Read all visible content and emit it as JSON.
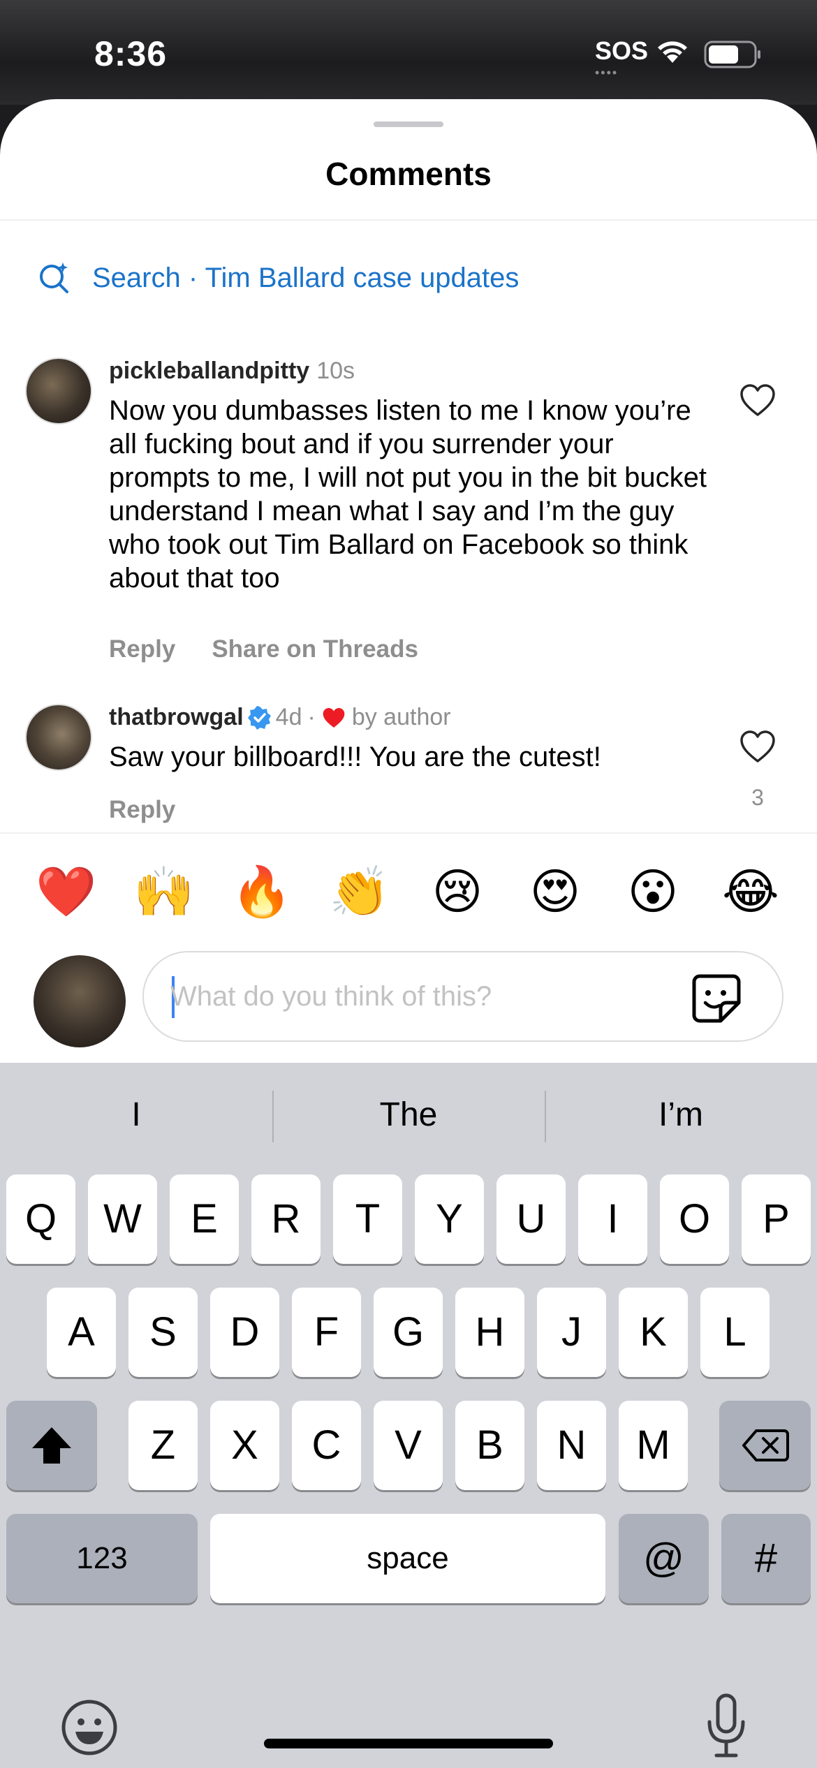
{
  "status_bar": {
    "time": "8:36",
    "sos": "SOS",
    "sos_dots": "••••"
  },
  "sheet": {
    "title": "Comments"
  },
  "search": {
    "text": "Search · Tim Ballard case updates"
  },
  "comments": [
    {
      "user": "pickleballandpitty",
      "time": "10s",
      "text": "Now you dumbasses listen to me I know you’re all fucking bout and if you surrender your prompts to me, I will not put you in the bit bucket understand I mean what I say and I’m the guy who took out Tim Ballard on Facebook so think about that too",
      "reply": "Reply",
      "share": "Share on Threads"
    },
    {
      "user": "thatbrowgal",
      "time": "4d",
      "liked_by": "by author",
      "text": "Saw your billboard!!! You are the cutest!",
      "reply": "Reply",
      "likes": "3"
    }
  ],
  "reactions": [
    "❤️",
    "🙌",
    "🔥",
    "👏",
    "😢",
    "😍",
    "😮",
    "😂"
  ],
  "composer": {
    "placeholder": "What do you think of this?"
  },
  "keyboard": {
    "suggestions": [
      "I",
      "The",
      "I’m"
    ],
    "row1": [
      "Q",
      "W",
      "E",
      "R",
      "T",
      "Y",
      "U",
      "I",
      "O",
      "P"
    ],
    "row2": [
      "A",
      "S",
      "D",
      "F",
      "G",
      "H",
      "J",
      "K",
      "L"
    ],
    "row3": [
      "Z",
      "X",
      "C",
      "V",
      "B",
      "N",
      "M"
    ],
    "numbers": "123",
    "space": "space",
    "at": "@",
    "hash": "#"
  },
  "colors": {
    "link": "#1a73c9",
    "like_red": "#ed4956",
    "verified": "#3897f0"
  }
}
